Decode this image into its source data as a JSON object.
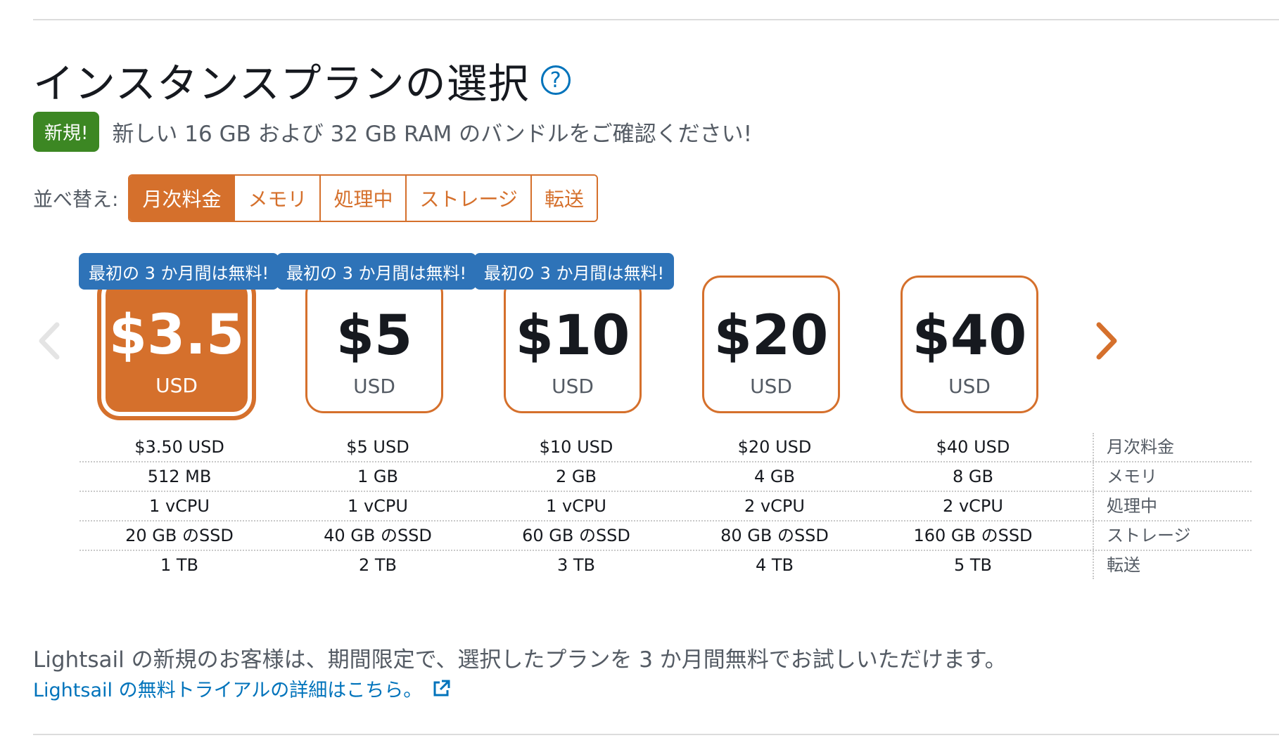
{
  "header": {
    "title": "インスタンスプランの選択",
    "help_icon": "?"
  },
  "notice": {
    "badge": "新規!",
    "text": "新しい 16 GB および 32 GB RAM のバンドルをご確認ください!"
  },
  "sort": {
    "label": "並べ替え:",
    "options": [
      "月次料金",
      "メモリ",
      "処理中",
      "ストレージ",
      "転送"
    ],
    "active": "月次料金"
  },
  "carousel": {
    "prev_icon": "chevron-left-icon",
    "next_icon": "chevron-right-icon"
  },
  "promo_label": "最初の 3 か月間は無料!",
  "plans": [
    {
      "price": "$3.5",
      "currency": "USD",
      "monthly": "$3.50 USD",
      "memory": "512 MB",
      "cpu": "1 vCPU",
      "storage": "20 GB のSSD",
      "transfer": "1 TB",
      "promo": true,
      "selected": true
    },
    {
      "price": "$5",
      "currency": "USD",
      "monthly": "$5 USD",
      "memory": "1 GB",
      "cpu": "1 vCPU",
      "storage": "40 GB のSSD",
      "transfer": "2 TB",
      "promo": true,
      "selected": false
    },
    {
      "price": "$10",
      "currency": "USD",
      "monthly": "$10 USD",
      "memory": "2 GB",
      "cpu": "1 vCPU",
      "storage": "60 GB のSSD",
      "transfer": "3 TB",
      "promo": true,
      "selected": false
    },
    {
      "price": "$20",
      "currency": "USD",
      "monthly": "$20 USD",
      "memory": "4 GB",
      "cpu": "2 vCPU",
      "storage": "80 GB のSSD",
      "transfer": "4 TB",
      "promo": false,
      "selected": false
    },
    {
      "price": "$40",
      "currency": "USD",
      "monthly": "$40 USD",
      "memory": "8 GB",
      "cpu": "2 vCPU",
      "storage": "160 GB のSSD",
      "transfer": "5 TB",
      "promo": false,
      "selected": false
    }
  ],
  "spec_labels": {
    "monthly": "月次料金",
    "memory": "メモリ",
    "cpu": "処理中",
    "storage": "ストレージ",
    "transfer": "転送"
  },
  "footer": {
    "text": "Lightsail の新規のお客様は、期間限定で、選択したプランを 3 か月間無料でお試しいただけます。",
    "link": "Lightsail の無料トライアルの詳細はこちら。",
    "link_icon": "external-link-icon"
  },
  "colors": {
    "accent": "#d5702c",
    "promo": "#2e73b8",
    "new_badge": "#3c8723",
    "link": "#0073bb"
  }
}
